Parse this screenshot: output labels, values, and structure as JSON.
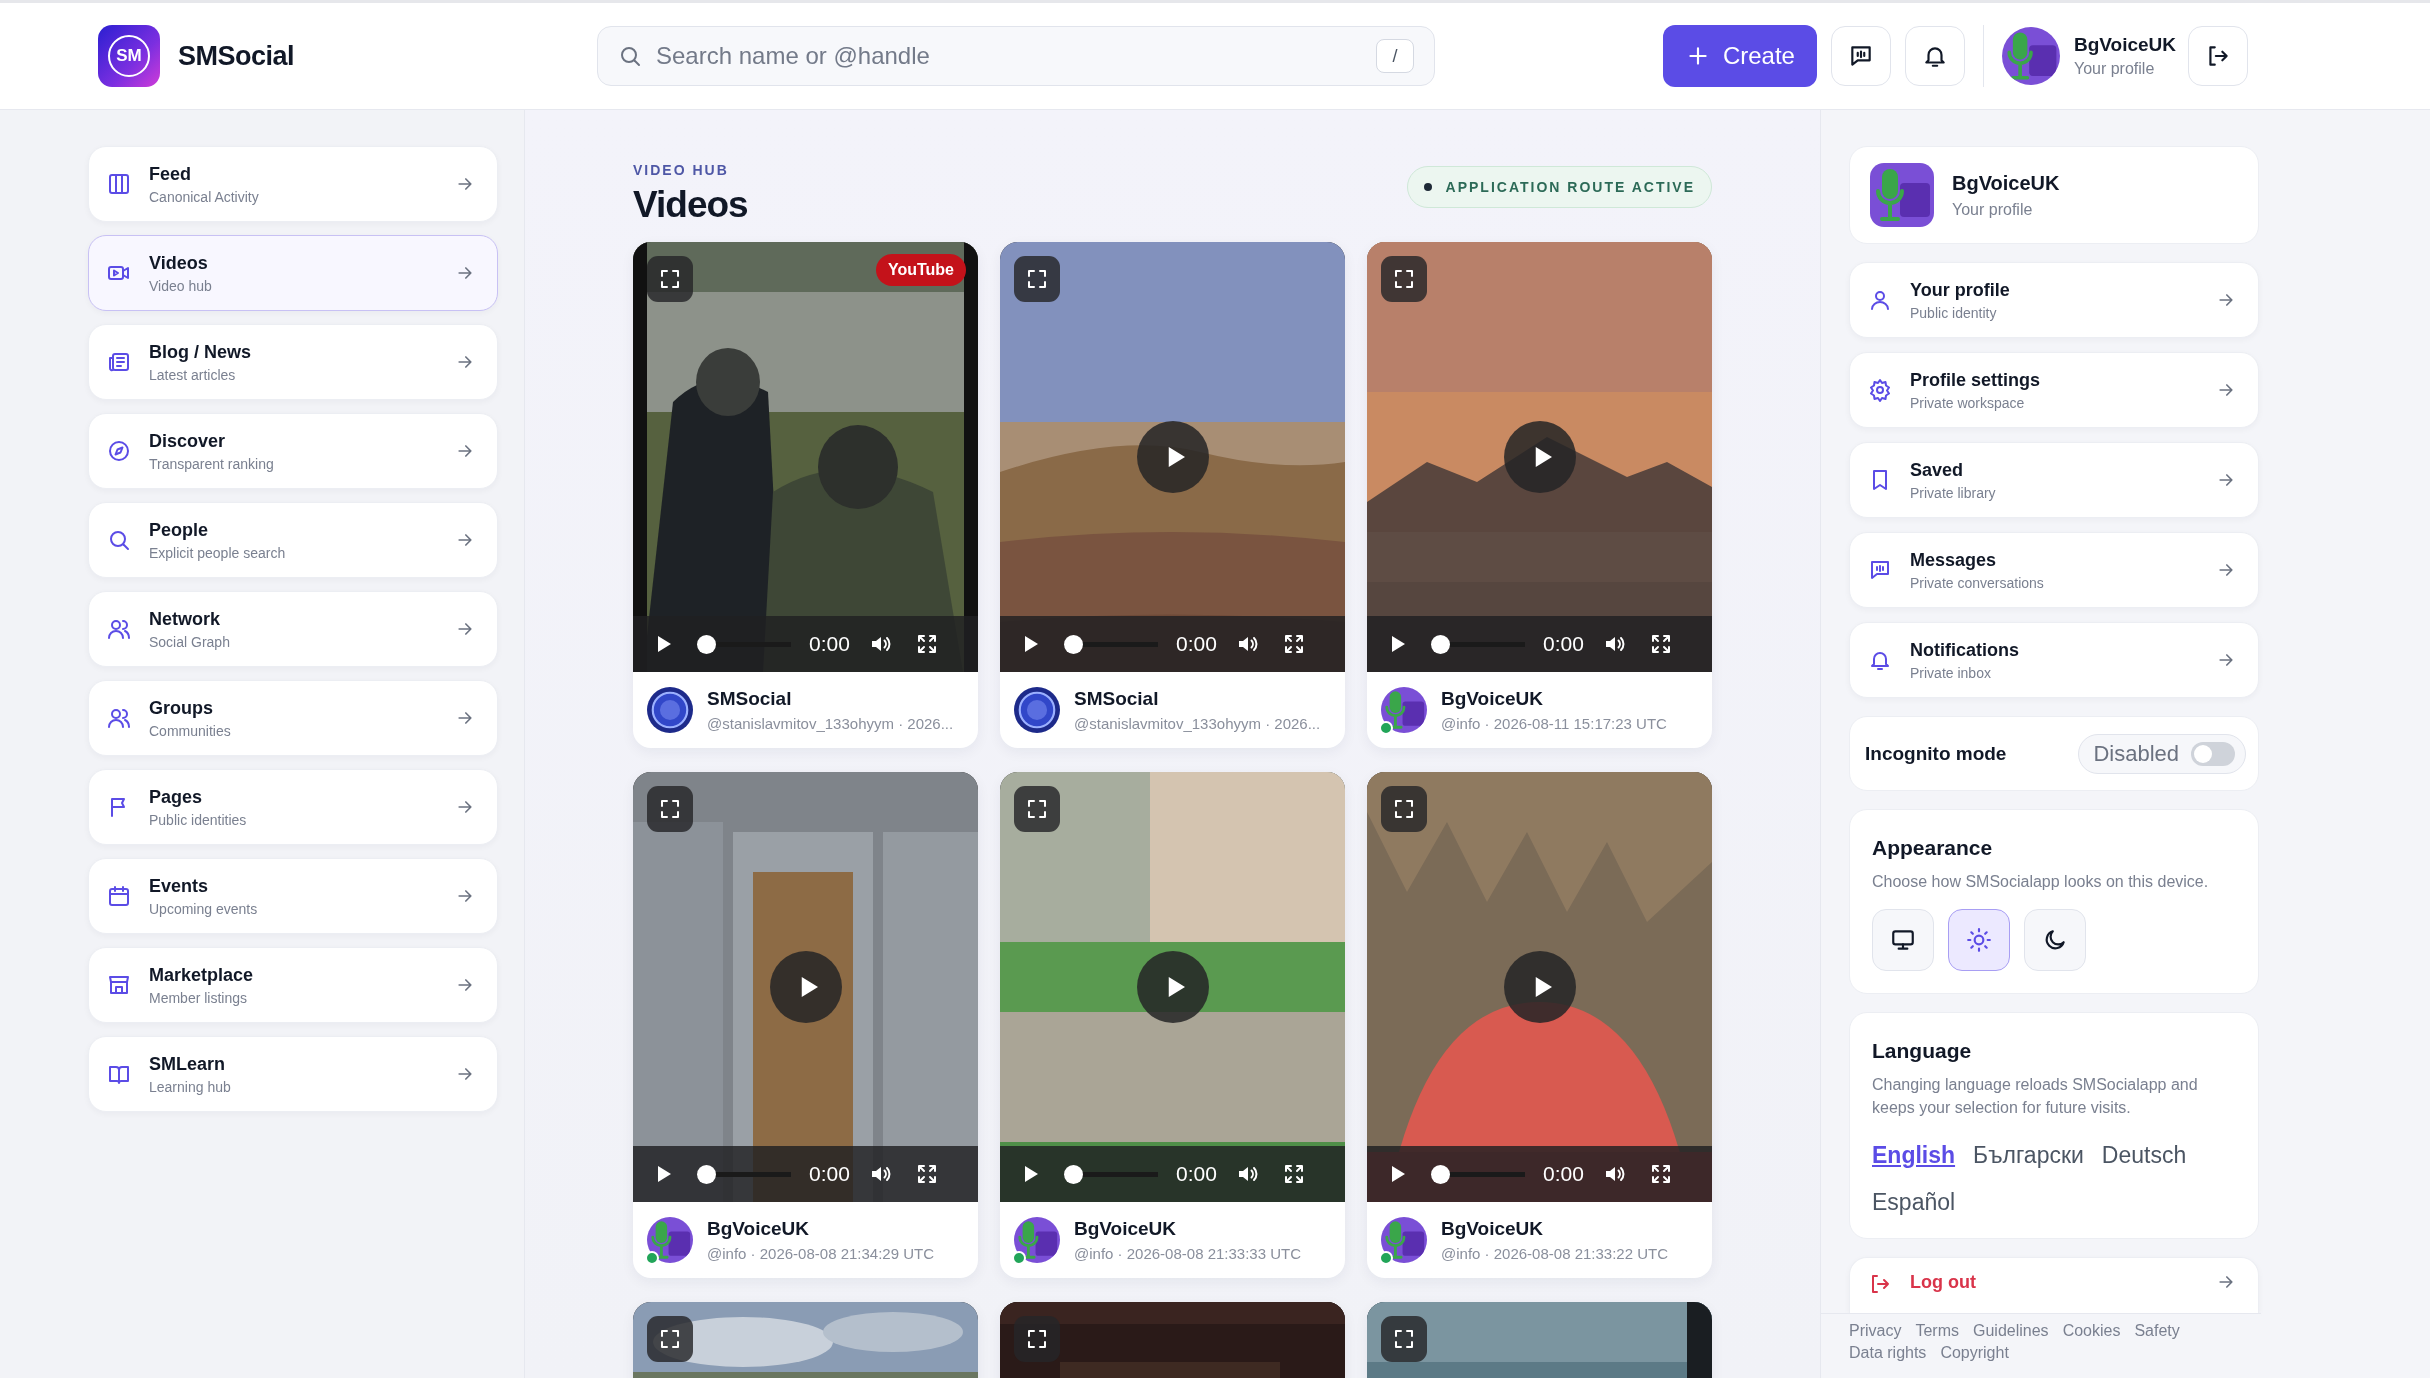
{
  "brand": {
    "logo_text": "SM",
    "name": "SMSocial"
  },
  "search": {
    "placeholder": "Search name or @handle",
    "shortcut": "/"
  },
  "header_actions": {
    "create_label": "Create",
    "user": {
      "name": "BgVoiceUK",
      "subtitle": "Your profile"
    }
  },
  "sidebar": {
    "items": [
      {
        "title": "Feed",
        "subtitle": "Canonical Activity",
        "selected": false
      },
      {
        "title": "Videos",
        "subtitle": "Video hub",
        "selected": true
      },
      {
        "title": "Blog / News",
        "subtitle": "Latest articles",
        "selected": false
      },
      {
        "title": "Discover",
        "subtitle": "Transparent ranking",
        "selected": false
      },
      {
        "title": "People",
        "subtitle": "Explicit people search",
        "selected": false
      },
      {
        "title": "Network",
        "subtitle": "Social Graph",
        "selected": false
      },
      {
        "title": "Groups",
        "subtitle": "Communities",
        "selected": false
      },
      {
        "title": "Pages",
        "subtitle": "Public identities",
        "selected": false
      },
      {
        "title": "Events",
        "subtitle": "Upcoming events",
        "selected": false
      },
      {
        "title": "Marketplace",
        "subtitle": "Member listings",
        "selected": false
      },
      {
        "title": "SMLearn",
        "subtitle": "Learning hub",
        "selected": false
      }
    ]
  },
  "main": {
    "eyebrow": "VIDEO HUB",
    "title": "Videos",
    "status_badge": "APPLICATION ROUTE ACTIVE",
    "videos": [
      {
        "kind": "full",
        "badge": "YouTube",
        "play_overlay": false,
        "time": "0:00",
        "level": 0,
        "author": {
          "kind": "logo",
          "name": "SMSocial",
          "online": false
        },
        "meta": "@stanislavmitov_133ohyym · 2026..."
      },
      {
        "kind": "full",
        "play_overlay": true,
        "time": "0:00",
        "level": 0,
        "author": {
          "kind": "logo",
          "name": "SMSocial",
          "online": false
        },
        "meta": "@stanislavmitov_133ohyym · 2026..."
      },
      {
        "kind": "full",
        "play_overlay": true,
        "time": "0:00",
        "level": 0,
        "author": {
          "kind": "user",
          "name": "BgVoiceUK",
          "online": true
        },
        "meta": "@info · 2026-08-11 15:17:23 UTC"
      },
      {
        "kind": "full",
        "play_overlay": true,
        "time": "0:00",
        "level": 0,
        "author": {
          "kind": "user",
          "name": "BgVoiceUK",
          "online": true
        },
        "meta": "@info · 2026-08-08 21:34:29 UTC"
      },
      {
        "kind": "full",
        "play_overlay": true,
        "time": "0:00",
        "level": 0,
        "author": {
          "kind": "user",
          "name": "BgVoiceUK",
          "online": true
        },
        "meta": "@info · 2026-08-08 21:33:33 UTC"
      },
      {
        "kind": "full",
        "play_overlay": true,
        "time": "0:00",
        "level": 0,
        "author": {
          "kind": "user",
          "name": "BgVoiceUK",
          "online": true
        },
        "meta": "@info · 2026-08-08 21:33:22 UTC"
      },
      {
        "kind": "peek"
      },
      {
        "kind": "peek"
      },
      {
        "kind": "peek"
      }
    ]
  },
  "rightbar": {
    "profile": {
      "name": "BgVoiceUK",
      "subtitle": "Your profile"
    },
    "links": [
      {
        "title": "Your profile",
        "subtitle": "Public identity"
      },
      {
        "title": "Profile settings",
        "subtitle": "Private workspace"
      },
      {
        "title": "Saved",
        "subtitle": "Private library"
      },
      {
        "title": "Messages",
        "subtitle": "Private conversations"
      },
      {
        "title": "Notifications",
        "subtitle": "Private inbox"
      }
    ],
    "incognito": {
      "label": "Incognito mode",
      "state_text": "Disabled",
      "on": false
    },
    "appearance": {
      "title": "Appearance",
      "description": "Choose how SMSocialapp looks on this device.",
      "modes": [
        {
          "kind": "system",
          "selected": false
        },
        {
          "kind": "light",
          "selected": true
        },
        {
          "kind": "dark",
          "selected": false
        }
      ]
    },
    "language": {
      "title": "Language",
      "description": "Changing language reloads SMSocialapp and keeps your selection for future visits.",
      "options": [
        {
          "label": "English",
          "selected": true
        },
        {
          "label": "Български",
          "selected": false
        },
        {
          "label": "Deutsch",
          "selected": false
        },
        {
          "label": "Español",
          "selected": false
        }
      ]
    },
    "logout": {
      "title": "Log out"
    },
    "footer_links": [
      "Privacy",
      "Terms",
      "Guidelines",
      "Cookies",
      "Safety",
      "Data rights",
      "Copyright"
    ]
  }
}
